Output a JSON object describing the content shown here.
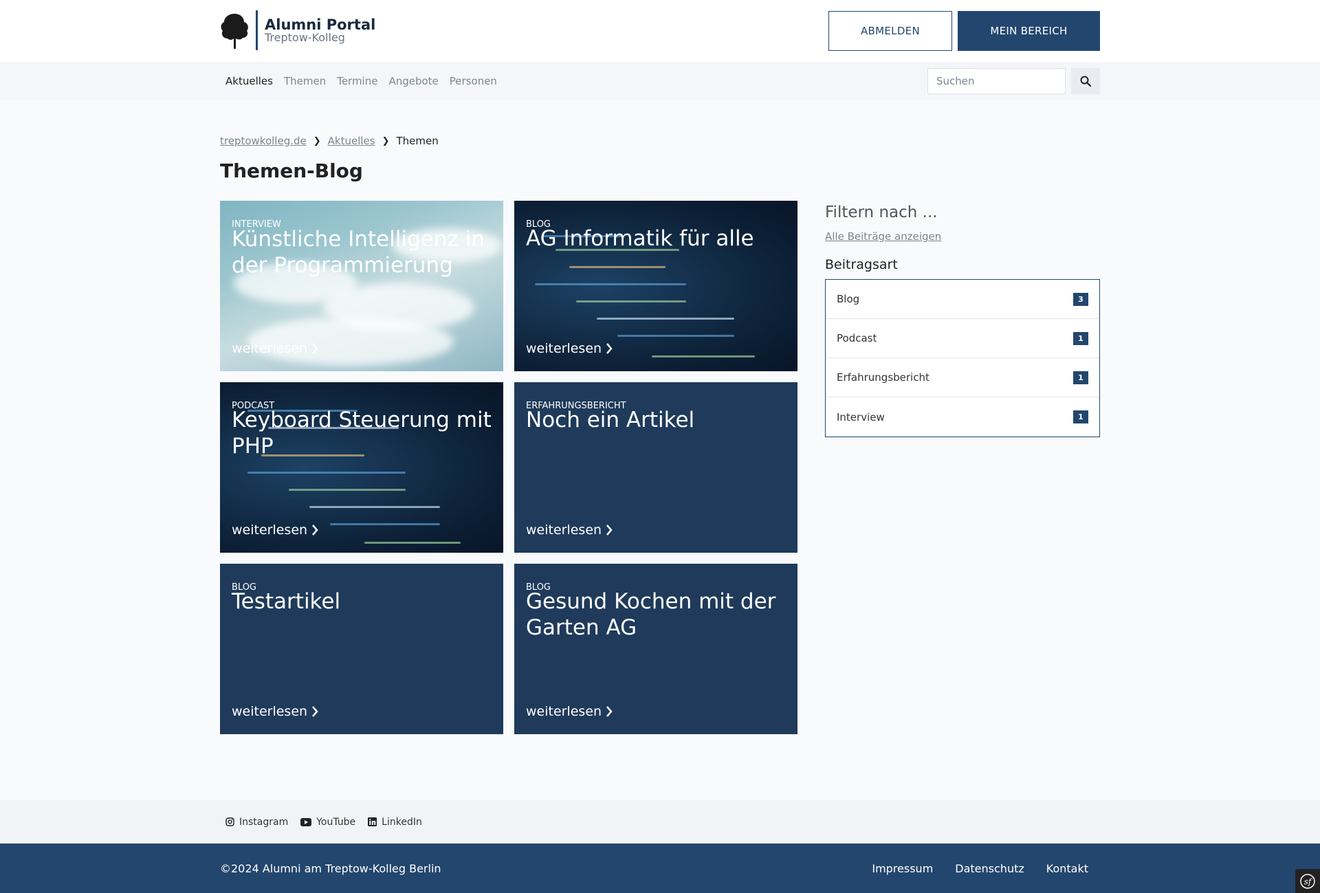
{
  "header": {
    "logo_title": "Alumni Portal",
    "logo_subtitle": "Treptow-Kolleg",
    "logout_label": "ABMELDEN",
    "my_area_label": "MEIN BEREICH"
  },
  "nav": {
    "items": [
      {
        "label": "Aktuelles",
        "active": true
      },
      {
        "label": "Themen",
        "active": false
      },
      {
        "label": "Termine",
        "active": false
      },
      {
        "label": "Angebote",
        "active": false
      },
      {
        "label": "Personen",
        "active": false
      }
    ],
    "search_placeholder": "Suchen"
  },
  "breadcrumb": {
    "items": [
      "treptowkolleg.de",
      "Aktuelles"
    ],
    "current": "Themen"
  },
  "page_title": "Themen-Blog",
  "cards": [
    {
      "type": "INTERVIEW",
      "title": "Künstliche Intelligenz in der Programmierung",
      "more": "weiterlesen",
      "background": "sky"
    },
    {
      "type": "BLOG",
      "title": "AG Informatik für alle",
      "more": "weiterlesen",
      "background": "code"
    },
    {
      "type": "PODCAST",
      "title": "Keyboard Steuerung mit PHP",
      "more": "weiterlesen",
      "background": "code"
    },
    {
      "type": "ERFAHRUNGSBERICHT",
      "title": "Noch ein Artikel",
      "more": "weiterlesen",
      "background": "plain"
    },
    {
      "type": "BLOG",
      "title": "Testartikel",
      "more": "weiterlesen",
      "background": "plain"
    },
    {
      "type": "BLOG",
      "title": "Gesund Kochen mit der Garten AG",
      "more": "weiterlesen",
      "background": "plain"
    }
  ],
  "filter": {
    "title": "Filtern nach ...",
    "show_all": "Alle Beiträge anzeigen",
    "subtitle": "Beitragsart",
    "items": [
      {
        "label": "Blog",
        "count": "3"
      },
      {
        "label": "Podcast",
        "count": "1"
      },
      {
        "label": "Erfahrungsbericht",
        "count": "1"
      },
      {
        "label": "Interview",
        "count": "1"
      }
    ]
  },
  "social": {
    "instagram": "Instagram",
    "youtube": "YouTube",
    "linkedin": "LinkedIn"
  },
  "footer": {
    "copyright": "©2024 Alumni am Treptow-Kolleg Berlin",
    "links": [
      "Impressum",
      "Datenschutz",
      "Kontakt"
    ]
  },
  "colors": {
    "brand": "#23466e",
    "card_bg": "#1f3a5a"
  }
}
